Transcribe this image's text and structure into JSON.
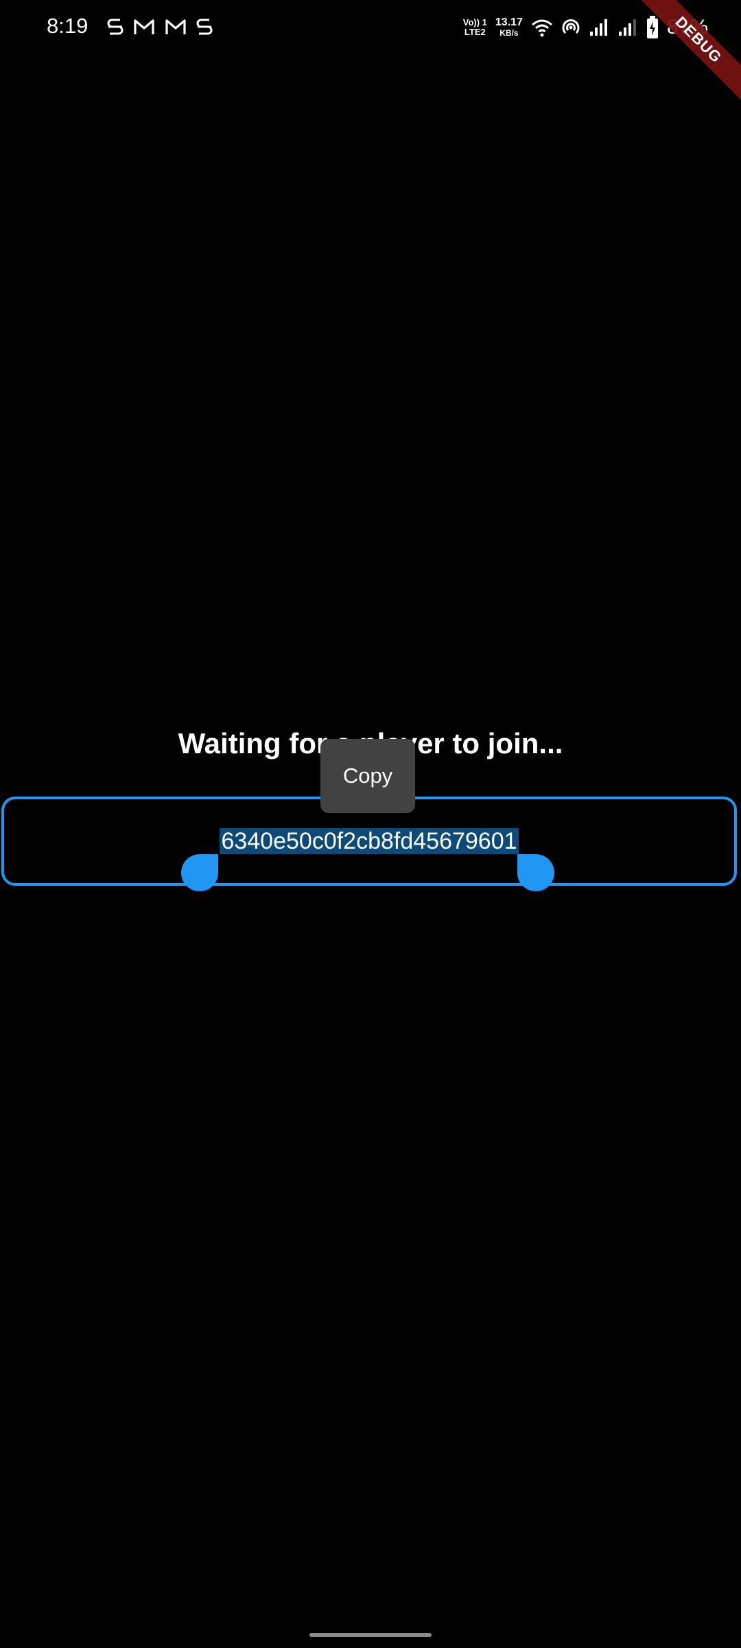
{
  "status_bar": {
    "time": "8:19",
    "notification_icons": [
      "s-app-icon",
      "gmail-icon",
      "gmail-icon",
      "s-app-icon"
    ],
    "volte": {
      "top": "Vo)) 1",
      "bottom": "LTE2"
    },
    "net_speed": {
      "value": "13.17",
      "unit": "KB/s"
    },
    "battery_percent": "87%"
  },
  "debug_banner": {
    "label": "DEBUG"
  },
  "main": {
    "waiting_text": "Waiting for a player to join...",
    "game_code": "6340e50c0f2cb8fd45679601"
  },
  "context_menu": {
    "copy_label": "Copy"
  },
  "colors": {
    "background": "#000000",
    "accent": "#2196f3",
    "selection": "#0d4a7a",
    "menu_background": "#424242",
    "debug_banner": "#781212"
  }
}
